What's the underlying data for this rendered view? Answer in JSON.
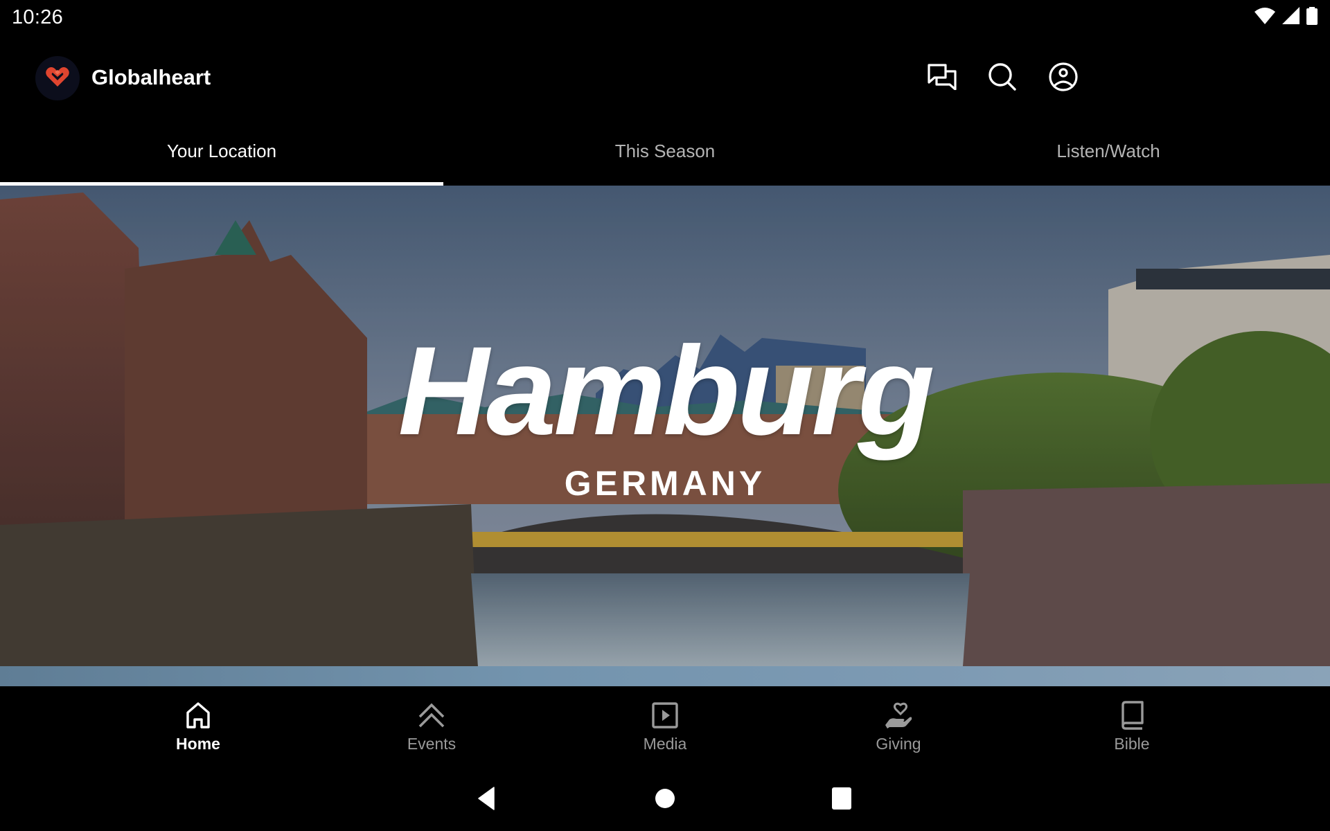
{
  "status_bar": {
    "time": "10:26",
    "icons": [
      "wifi-icon",
      "cellular-signal-icon",
      "battery-icon"
    ]
  },
  "app_bar": {
    "title": "Globalheart",
    "logo": "globalheart-heart-logo",
    "brand_color": "#e0452f",
    "actions": [
      {
        "name": "messages",
        "icon": "chat-bubbles-icon"
      },
      {
        "name": "search",
        "icon": "search-icon"
      },
      {
        "name": "account",
        "icon": "account-circle-icon"
      }
    ]
  },
  "tabs": [
    {
      "label": "Your Location",
      "active": true
    },
    {
      "label": "This Season",
      "active": false
    },
    {
      "label": "Listen/Watch",
      "active": false
    }
  ],
  "hero": {
    "title": "Hamburg",
    "subtitle": "GERMANY",
    "image_description": "Hamburg Speicherstadt canal at dusk with bridge and Elbphilharmonie"
  },
  "bottom_nav": [
    {
      "label": "Home",
      "icon": "home-icon",
      "active": true
    },
    {
      "label": "Events",
      "icon": "double-chevron-up-icon",
      "active": false
    },
    {
      "label": "Media",
      "icon": "play-box-icon",
      "active": false
    },
    {
      "label": "Giving",
      "icon": "hand-heart-icon",
      "active": false
    },
    {
      "label": "Bible",
      "icon": "book-icon",
      "active": false
    }
  ],
  "system_nav": {
    "buttons": [
      "back",
      "home",
      "recents"
    ]
  }
}
